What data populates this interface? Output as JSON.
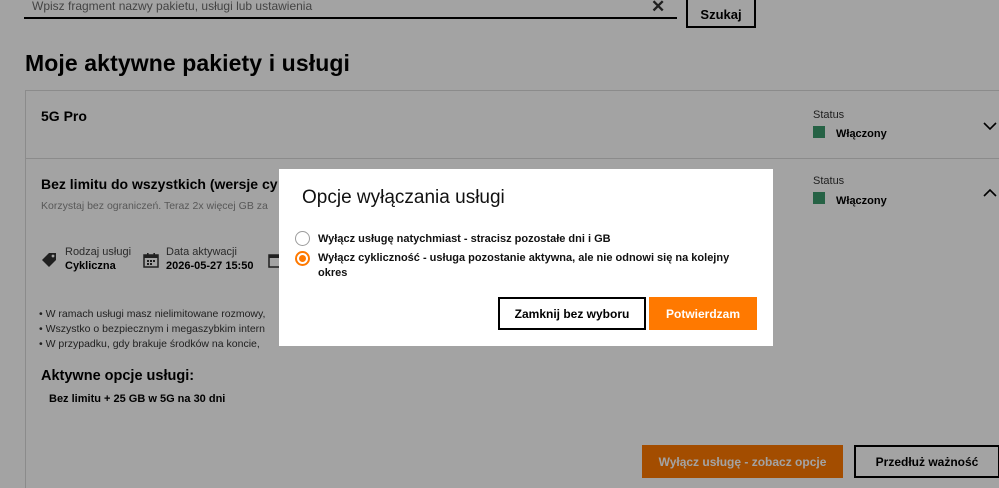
{
  "search": {
    "placeholder": "Wpisz fragment nazwy pakietu, usługi lub ustawienia",
    "clear_icon": "close-icon",
    "button_label": "Szukaj"
  },
  "page": {
    "title": "Moje aktywne pakiety i usługi"
  },
  "packages": [
    {
      "name": "5G Pro",
      "status_label": "Status",
      "status_value": "Włączony",
      "status_color": "#3c9a6d",
      "expanded": false
    },
    {
      "name": "Bez limitu do wszystkich (wersje cy",
      "description": "Korzystaj bez ograniczeń. Teraz 2x więcej GB za",
      "status_label": "Status",
      "status_value": "Włączony",
      "status_color": "#3c9a6d",
      "expanded": true,
      "meta": {
        "type_label": "Rodzaj usługi",
        "type_value": "Cykliczna",
        "activation_label": "Data aktywacji",
        "activation_value": "2026-05-27 15:50"
      },
      "bullets": [
        "• W ramach usługi masz nielimitowane rozmowy,",
        "• Wszystko o bezpiecznym i megaszybkim intern",
        "• W przypadku, gdy brakuje środków na koncie,"
      ],
      "options_title": "Aktywne opcje usługi:",
      "options": [
        "Bez limitu + 25 GB w 5G na 30 dni"
      ],
      "disable_button": "Wyłącz usługę - zobacz opcje",
      "extend_button": "Przedłuż ważność"
    }
  ],
  "modal": {
    "title": "Opcje wyłączania usługi",
    "options": [
      {
        "label": "Wyłącz usługę natychmiast - stracisz pozostałe dni i GB",
        "selected": false
      },
      {
        "label": "Wyłącz cykliczność - usługa pozostanie aktywna, ale nie odnowi się na kolejny okres",
        "selected": true
      }
    ],
    "close_button": "Zamknij bez wyboru",
    "confirm_button": "Potwierdzam"
  },
  "colors": {
    "accent": "#ff7900",
    "status_green": "#3c9a6d"
  }
}
